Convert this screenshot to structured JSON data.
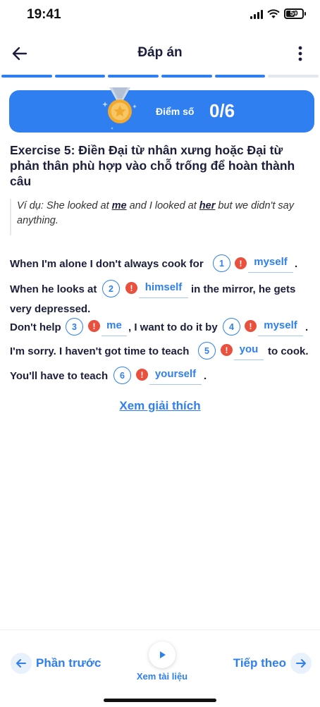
{
  "status_bar": {
    "time": "19:41",
    "battery": "50"
  },
  "header": {
    "title": "Đáp án"
  },
  "progress": {
    "segments": 6,
    "completed": 5,
    "active_color": "#2f7ff0",
    "inactive_color": "#e3e6ee"
  },
  "score": {
    "label": "Điểm số",
    "value": "0/6"
  },
  "exercise": {
    "title": "Exercise 5: Điền Đại từ nhân xưng hoặc Đại từ phản thân phù hợp vào chỗ trống để hoàn thành câu",
    "example": {
      "part1": "Ví dụ: She looked at ",
      "word1": "me",
      "part2": " and I looked at ",
      "word2": "her",
      "part3": " but we didn't say anything."
    }
  },
  "questions": {
    "s1_before": "When I'm alone I don't always cook for",
    "s1_after": ".",
    "s2_before": "When he looks at",
    "s2_after": "in the mirror, he gets",
    "s2_line2": "very depressed.",
    "s3_before": "Don't help",
    "s3_middle": ", I want to do it by",
    "s3_after": ".",
    "s4_before": "I'm sorry. I haven't got time to teach",
    "s4_after": "to cook.",
    "s5_before": "You'll have to teach",
    "s5_after": ".",
    "blanks": [
      {
        "number": "1",
        "answer": "myself",
        "status": "wrong"
      },
      {
        "number": "2",
        "answer": "himself",
        "status": "wrong"
      },
      {
        "number": "3",
        "answer": "me",
        "status": "wrong"
      },
      {
        "number": "4",
        "answer": "myself",
        "status": "wrong"
      },
      {
        "number": "5",
        "answer": "you",
        "status": "wrong"
      },
      {
        "number": "6",
        "answer": "yourself",
        "status": "wrong"
      }
    ],
    "warn_glyph": "!"
  },
  "explain_link": "Xem giải thích",
  "bottom_nav": {
    "prev_label": "Phần trước",
    "doc_label": "Xem tài liệu",
    "next_label": "Tiếp theo"
  },
  "colors": {
    "accent": "#2f7ff0",
    "error": "#e9503e",
    "text": "#1b1f3b"
  }
}
